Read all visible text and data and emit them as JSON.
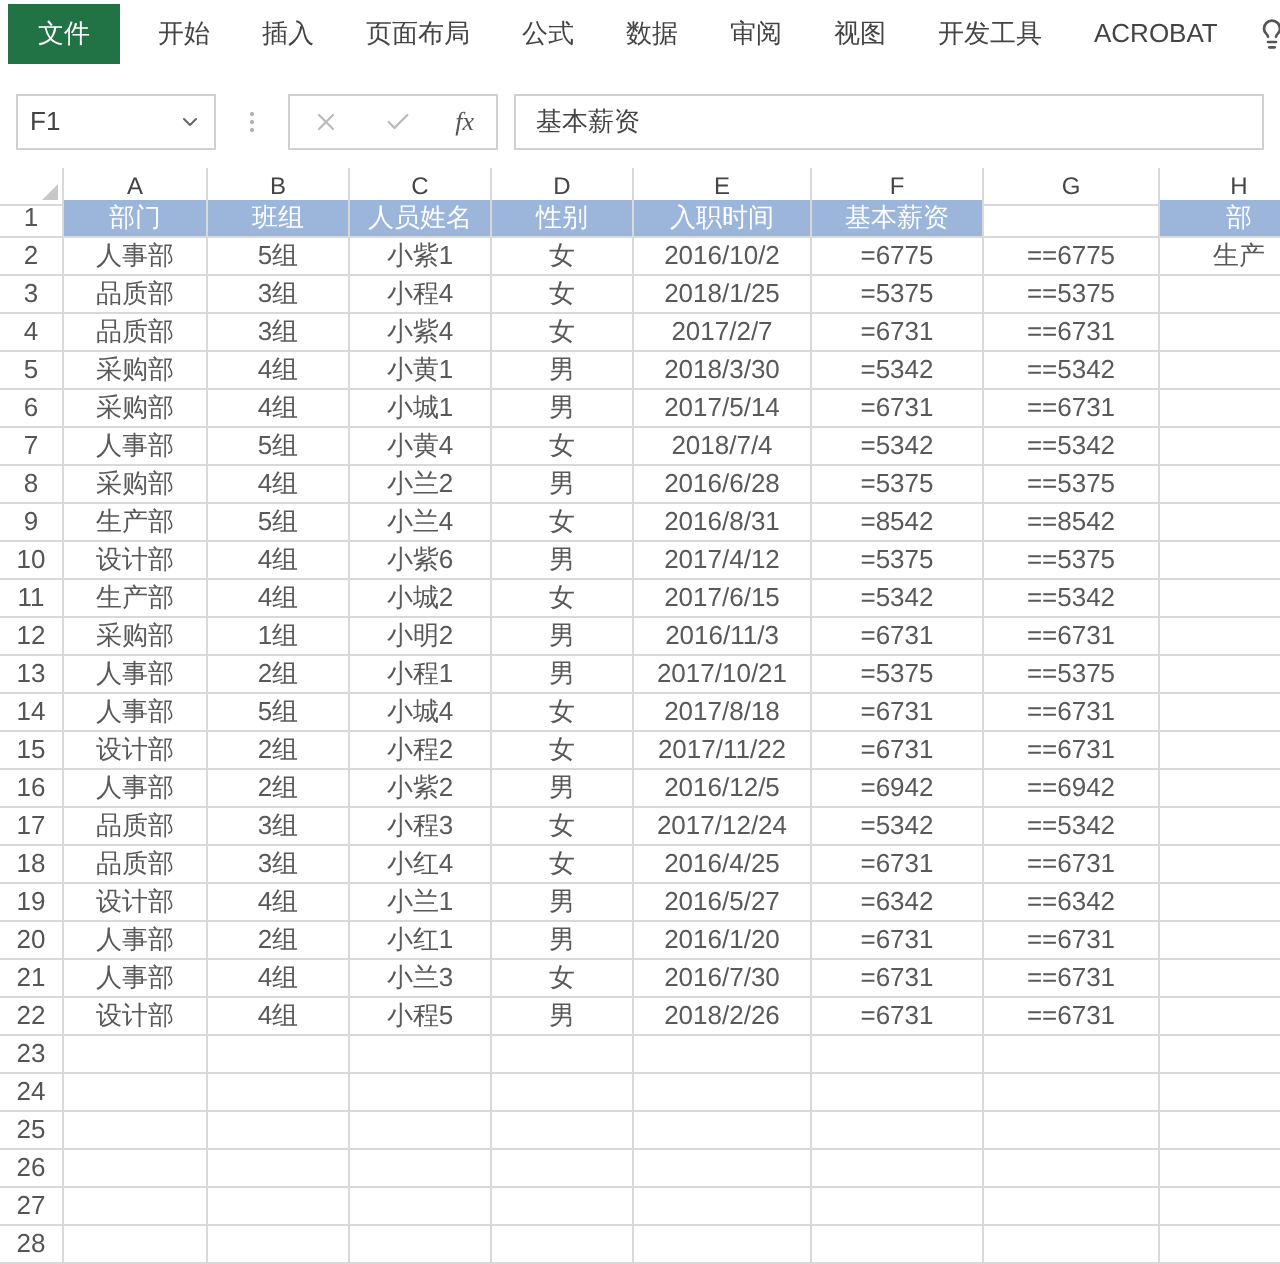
{
  "ribbon": {
    "tabs": [
      {
        "label": "文件",
        "selected": true
      },
      {
        "label": "开始",
        "selected": false
      },
      {
        "label": "插入",
        "selected": false
      },
      {
        "label": "页面布局",
        "selected": false
      },
      {
        "label": "公式",
        "selected": false
      },
      {
        "label": "数据",
        "selected": false
      },
      {
        "label": "审阅",
        "selected": false
      },
      {
        "label": "视图",
        "selected": false
      },
      {
        "label": "开发工具",
        "selected": false
      },
      {
        "label": "ACROBAT",
        "selected": false
      }
    ]
  },
  "formula_bar": {
    "name_box": "F1",
    "function_label": "fx",
    "value": "基本薪资"
  },
  "column_headers": [
    "A",
    "B",
    "C",
    "D",
    "E",
    "F",
    "G",
    "H"
  ],
  "rows": [
    {
      "number": "1",
      "kind": "header",
      "cells": {
        "A": "部门",
        "B": "班组",
        "C": "人员姓名",
        "D": "性别",
        "E": "入职时间",
        "F": "基本薪资",
        "H": "部"
      }
    },
    {
      "number": "2",
      "kind": "data",
      "cells": {
        "A": "人事部",
        "B": "5组",
        "C": "小紫1",
        "D": "女",
        "E": "2016/10/2",
        "F": "=6775",
        "G": "==6775",
        "H": "生产"
      }
    },
    {
      "number": "3",
      "kind": "data",
      "cells": {
        "A": "品质部",
        "B": "3组",
        "C": "小程4",
        "D": "女",
        "E": "2018/1/25",
        "F": "=5375",
        "G": "==5375"
      }
    },
    {
      "number": "4",
      "kind": "data",
      "cells": {
        "A": "品质部",
        "B": "3组",
        "C": "小紫4",
        "D": "女",
        "E": "2017/2/7",
        "F": "=6731",
        "G": "==6731"
      }
    },
    {
      "number": "5",
      "kind": "data",
      "cells": {
        "A": "采购部",
        "B": "4组",
        "C": "小黄1",
        "D": "男",
        "E": "2018/3/30",
        "F": "=5342",
        "G": "==5342"
      }
    },
    {
      "number": "6",
      "kind": "data",
      "cells": {
        "A": "采购部",
        "B": "4组",
        "C": "小城1",
        "D": "男",
        "E": "2017/5/14",
        "F": "=6731",
        "G": "==6731"
      }
    },
    {
      "number": "7",
      "kind": "data",
      "cells": {
        "A": "人事部",
        "B": "5组",
        "C": "小黄4",
        "D": "女",
        "E": "2018/7/4",
        "F": "=5342",
        "G": "==5342"
      }
    },
    {
      "number": "8",
      "kind": "data",
      "cells": {
        "A": "采购部",
        "B": "4组",
        "C": "小兰2",
        "D": "男",
        "E": "2016/6/28",
        "F": "=5375",
        "G": "==5375"
      }
    },
    {
      "number": "9",
      "kind": "data",
      "cells": {
        "A": "生产部",
        "B": "5组",
        "C": "小兰4",
        "D": "女",
        "E": "2016/8/31",
        "F": "=8542",
        "G": "==8542"
      }
    },
    {
      "number": "10",
      "kind": "data",
      "cells": {
        "A": "设计部",
        "B": "4组",
        "C": "小紫6",
        "D": "男",
        "E": "2017/4/12",
        "F": "=5375",
        "G": "==5375"
      }
    },
    {
      "number": "11",
      "kind": "data",
      "cells": {
        "A": "生产部",
        "B": "4组",
        "C": "小城2",
        "D": "女",
        "E": "2017/6/15",
        "F": "=5342",
        "G": "==5342"
      }
    },
    {
      "number": "12",
      "kind": "data",
      "cells": {
        "A": "采购部",
        "B": "1组",
        "C": "小明2",
        "D": "男",
        "E": "2016/11/3",
        "F": "=6731",
        "G": "==6731"
      }
    },
    {
      "number": "13",
      "kind": "data",
      "cells": {
        "A": "人事部",
        "B": "2组",
        "C": "小程1",
        "D": "男",
        "E": "2017/10/21",
        "F": "=5375",
        "G": "==5375"
      }
    },
    {
      "number": "14",
      "kind": "data",
      "cells": {
        "A": "人事部",
        "B": "5组",
        "C": "小城4",
        "D": "女",
        "E": "2017/8/18",
        "F": "=6731",
        "G": "==6731"
      }
    },
    {
      "number": "15",
      "kind": "data",
      "cells": {
        "A": "设计部",
        "B": "2组",
        "C": "小程2",
        "D": "女",
        "E": "2017/11/22",
        "F": "=6731",
        "G": "==6731"
      }
    },
    {
      "number": "16",
      "kind": "data",
      "cells": {
        "A": "人事部",
        "B": "2组",
        "C": "小紫2",
        "D": "男",
        "E": "2016/12/5",
        "F": "=6942",
        "G": "==6942"
      }
    },
    {
      "number": "17",
      "kind": "data",
      "cells": {
        "A": "品质部",
        "B": "3组",
        "C": "小程3",
        "D": "女",
        "E": "2017/12/24",
        "F": "=5342",
        "G": "==5342"
      }
    },
    {
      "number": "18",
      "kind": "data",
      "cells": {
        "A": "品质部",
        "B": "3组",
        "C": "小红4",
        "D": "女",
        "E": "2016/4/25",
        "F": "=6731",
        "G": "==6731"
      }
    },
    {
      "number": "19",
      "kind": "data",
      "cells": {
        "A": "设计部",
        "B": "4组",
        "C": "小兰1",
        "D": "男",
        "E": "2016/5/27",
        "F": "=6342",
        "G": "==6342"
      }
    },
    {
      "number": "20",
      "kind": "data",
      "cells": {
        "A": "人事部",
        "B": "2组",
        "C": "小红1",
        "D": "男",
        "E": "2016/1/20",
        "F": "=6731",
        "G": "==6731"
      }
    },
    {
      "number": "21",
      "kind": "data",
      "cells": {
        "A": "人事部",
        "B": "4组",
        "C": "小兰3",
        "D": "女",
        "E": "2016/7/30",
        "F": "=6731",
        "G": "==6731"
      }
    },
    {
      "number": "22",
      "kind": "data",
      "cells": {
        "A": "设计部",
        "B": "4组",
        "C": "小程5",
        "D": "男",
        "E": "2018/2/26",
        "F": "=6731",
        "G": "==6731"
      }
    },
    {
      "number": "23",
      "kind": "data",
      "cells": {}
    },
    {
      "number": "24",
      "kind": "data",
      "cells": {}
    },
    {
      "number": "25",
      "kind": "data",
      "cells": {}
    },
    {
      "number": "26",
      "kind": "data",
      "cells": {}
    },
    {
      "number": "27",
      "kind": "data",
      "cells": {}
    },
    {
      "number": "28",
      "kind": "data",
      "cells": {}
    }
  ]
}
